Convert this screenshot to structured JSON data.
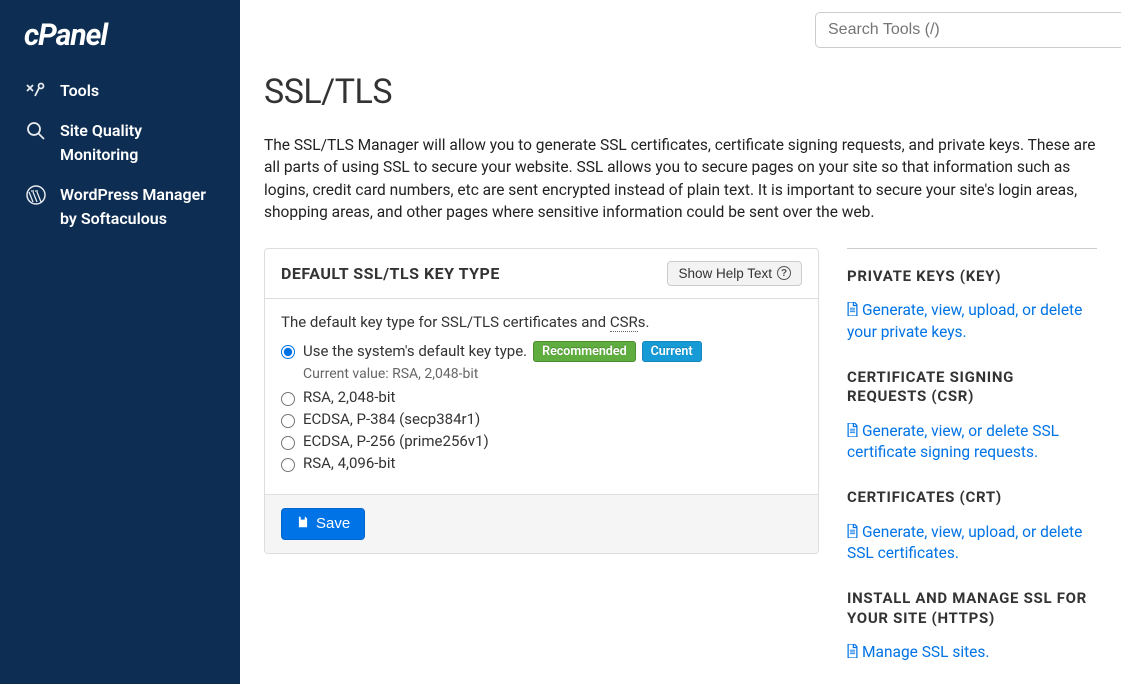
{
  "brand": "cPanel",
  "search": {
    "placeholder": "Search Tools (/)"
  },
  "sidebar": {
    "items": [
      {
        "label": "Tools"
      },
      {
        "label": "Site Quality Monitoring"
      },
      {
        "label": "WordPress Manager by Softaculous"
      }
    ]
  },
  "page": {
    "title": "SSL/TLS",
    "description": "The SSL/TLS Manager will allow you to generate SSL certificates, certificate signing requests, and private keys. These are all parts of using SSL to secure your website. SSL allows you to secure pages on your site so that information such as logins, credit card numbers, etc are sent encrypted instead of plain text. It is important to secure your site's login areas, shopping areas, and other pages where sensitive information could be sent over the web."
  },
  "card": {
    "title": "DEFAULT SSL/TLS KEY TYPE",
    "help_button": "Show Help Text",
    "body_desc_prefix": "The default key type for SSL/TLS certificates and ",
    "body_desc_csr": "CSR",
    "body_desc_suffix": "s.",
    "options": [
      {
        "label": "Use the system's default key type.",
        "checked": true,
        "recommended": "Recommended",
        "current": "Current"
      },
      {
        "label": "RSA, 2,048-bit"
      },
      {
        "label": "ECDSA, P-384 (secp384r1)"
      },
      {
        "label": "ECDSA, P-256 (prime256v1)"
      },
      {
        "label": "RSA, 4,096-bit"
      }
    ],
    "current_value": "Current value: RSA, 2,048-bit",
    "save_label": "Save"
  },
  "right": {
    "sections": [
      {
        "title": "PRIVATE KEYS (KEY)",
        "link": "Generate, view, upload, or delete your private keys."
      },
      {
        "title": "CERTIFICATE SIGNING REQUESTS (CSR)",
        "link": "Generate, view, or delete SSL certificate signing requests."
      },
      {
        "title": "CERTIFICATES (CRT)",
        "link": "Generate, view, upload, or delete SSL certificates."
      },
      {
        "title": "INSTALL AND MANAGE SSL FOR YOUR SITE (HTTPS)",
        "link": "Manage SSL sites."
      }
    ]
  }
}
